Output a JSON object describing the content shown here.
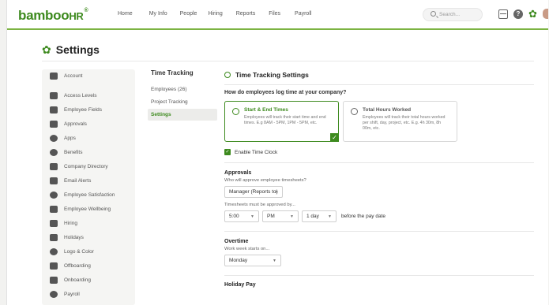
{
  "brand": {
    "logo": "bamboo",
    "logo_hr": "HR",
    "logo_reg": "®",
    "accent": "#3d8a1e"
  },
  "nav": {
    "links": [
      "Home",
      "My Info",
      "People",
      "Hiring",
      "Reports",
      "Files",
      "Payroll"
    ],
    "search_placeholder": "Search..."
  },
  "page": {
    "title": "Settings"
  },
  "sidebar": {
    "items": [
      {
        "label": "Account",
        "icon": "wrench-icon"
      },
      {
        "label": "Access Levels",
        "icon": "lock-icon"
      },
      {
        "label": "Employee Fields",
        "icon": "fields-icon"
      },
      {
        "label": "Approvals",
        "icon": "thumbs-up-icon"
      },
      {
        "label": "Apps",
        "icon": "cloud-icon"
      },
      {
        "label": "Benefits",
        "icon": "heart-icon"
      },
      {
        "label": "Company Directory",
        "icon": "directory-icon"
      },
      {
        "label": "Email Alerts",
        "icon": "email-icon"
      },
      {
        "label": "Employee Satisfaction",
        "icon": "smile-icon"
      },
      {
        "label": "Employee Wellbeing",
        "icon": "wellbeing-icon"
      },
      {
        "label": "Hiring",
        "icon": "clipboard-icon"
      },
      {
        "label": "Holidays",
        "icon": "gift-icon"
      },
      {
        "label": "Logo & Color",
        "icon": "palette-icon"
      },
      {
        "label": "Offboarding",
        "icon": "offboarding-icon"
      },
      {
        "label": "Onboarding",
        "icon": "onboarding-icon"
      },
      {
        "label": "Payroll",
        "icon": "dollar-icon"
      }
    ]
  },
  "subnav": {
    "heading": "Time Tracking",
    "items": [
      "Employees (26)",
      "Project Tracking",
      "Settings"
    ],
    "active": "Settings"
  },
  "main": {
    "title": "Time Tracking Settings",
    "question": "How do employees log time at your company?",
    "options": [
      {
        "title": "Start & End Times",
        "desc": "Employees will track their start time and end times. E.g 8AM - 5PM, 1PM - 5PM, etc.",
        "selected": true
      },
      {
        "title": "Total Hours Worked",
        "desc": "Employees will track their total hours worked per shift, day, project, etc. E.g. 4h 30m, 8h 00m, etc.",
        "selected": false
      }
    ],
    "time_clock_label": "Enable Time Clock",
    "approvals": {
      "title": "Approvals",
      "who_label": "Who will approve employee timesheets?",
      "who_value": "Manager (Reports to)",
      "by_label": "Timesheets must be approved by...",
      "time_value": "5:00",
      "ampm_value": "PM",
      "day_value": "1 day",
      "after_text": "before the pay date"
    },
    "overtime": {
      "title": "Overtime",
      "week_label": "Work week starts on...",
      "week_value": "Monday"
    },
    "holiday_title": "Holiday Pay"
  }
}
